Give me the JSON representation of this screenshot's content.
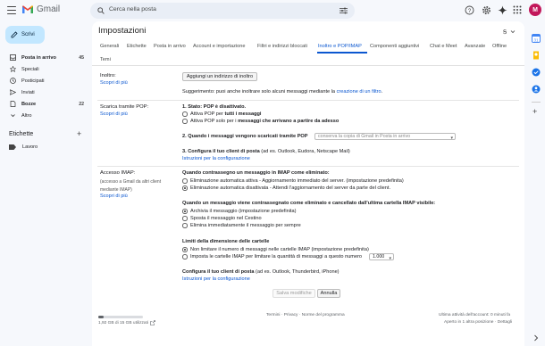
{
  "app": {
    "name": "Gmail"
  },
  "search": {
    "placeholder": "Cerca nella posta"
  },
  "avatar": {
    "initial": "M",
    "color": "#c2185b"
  },
  "sidebar": {
    "compose_label": "Scrivi",
    "items": [
      {
        "label": "Posta in arrivo",
        "count": "45",
        "icon": "inbox-icon",
        "bold": true
      },
      {
        "label": "Speciali",
        "count": "",
        "icon": "star-icon",
        "bold": false
      },
      {
        "label": "Posticipati",
        "count": "",
        "icon": "clock-icon",
        "bold": false
      },
      {
        "label": "Inviati",
        "count": "",
        "icon": "send-icon",
        "bold": false
      },
      {
        "label": "Bozze",
        "count": "22",
        "icon": "draft-icon",
        "bold": true
      },
      {
        "label": "Altro",
        "count": "",
        "icon": "chevron-down-icon",
        "bold": false
      }
    ],
    "labels_heading": "Etichette",
    "labels": [
      {
        "label": "Lavoro"
      }
    ]
  },
  "settings": {
    "title": "Impostazioni",
    "tabs": [
      "Generali",
      "Etichette",
      "Posta in arrivo",
      "Account e importazione",
      "Filtri e indirizzi bloccati",
      "Inoltro e POP/IMAP",
      "Componenti aggiuntivi",
      "Chat e Meet",
      "Avanzate",
      "Offline",
      "Temi"
    ],
    "active_tab": "Inoltro e POP/IMAP",
    "forwarding": {
      "label": "Inoltro:",
      "learn_more": "Scopri di più",
      "add_button": "Aggiungi un indirizzo di inoltro",
      "tip_text": "Suggerimento: puoi anche inoltrare solo alcuni messaggi mediante la",
      "tip_link": "creazione di un filtro",
      "tip_end": "."
    },
    "pop": {
      "label": "Scarica tramite POP:",
      "learn_more": "Scopri di più",
      "status": "1. Stato: POP è disattivato.",
      "opt1_pre": "Attiva POP per ",
      "opt1_bold": "tutti i messaggi",
      "opt2_pre": "Attiva POP solo per i ",
      "opt2_bold": "messaggi che arrivano a partire da adesso",
      "q2": "2. Quando i messaggi vengono scaricati tramite POP",
      "q2_select": "conserva la copia di Gmail in Posta in arrivo",
      "q3_bold": "3. Configura il tuo client di posta",
      "q3_rest": " (ad es. Outlook, Eudora, Netscape Mail)",
      "q3_link": "Istruzioni per la configurazione"
    },
    "imap": {
      "label": "Accesso IMAP:",
      "sub": "(accesso a Gmail da altri client mediante IMAP)",
      "learn_more": "Scopri di più",
      "h1": "Quando contrassegno un messaggio in IMAP come eliminato:",
      "h1_opts": [
        "Eliminazione automatica attiva - Aggiornamento immediato del server. (impostazione predefinita)",
        "Eliminazione automatica disattivata - Attendi l'aggiornamento del server da parte del client."
      ],
      "h1_selected": 1,
      "h2": "Quando un messaggio viene contrassegnato come eliminato e cancellato dall'ultima cartella IMAP visibile:",
      "h2_opts": [
        "Archivia il messaggio (impostazione predefinita)",
        "Sposta il messaggio nel Cestino",
        "Elimina immediatamente il messaggio per sempre"
      ],
      "h2_selected": 0,
      "h3": "Limiti della dimensione delle cartelle",
      "h3_opts": [
        "Non limitare il numero di messaggi nelle cartelle IMAP (impostazione predefinita)",
        "Imposta le cartelle IMAP per limitare la quantità di messaggi a questo numero"
      ],
      "h3_selected": 0,
      "limit_value": "1.000",
      "client_bold": "Configura il tuo client di posta",
      "client_rest": " (ad es. Outlook, Thunderbird, iPhone)",
      "client_link": "Istruzioni per la configurazione"
    },
    "buttons": {
      "save": "Salva modifiche",
      "cancel": "Annulla"
    }
  },
  "footer": {
    "storage": "1,92 GB di 15 GB utilizzati",
    "storage_fraction": 0.128,
    "links": "Termini · Privacy · Norme del programma",
    "activity": "Ultima attività dell'account: 0 minuti fa",
    "open_in": "Aperto in 1 altra posizione · Dettagli"
  },
  "colors": {
    "accent": "#0b57d0",
    "compose_bg": "#c2e7ff",
    "page_bg": "#f6f8fc"
  }
}
